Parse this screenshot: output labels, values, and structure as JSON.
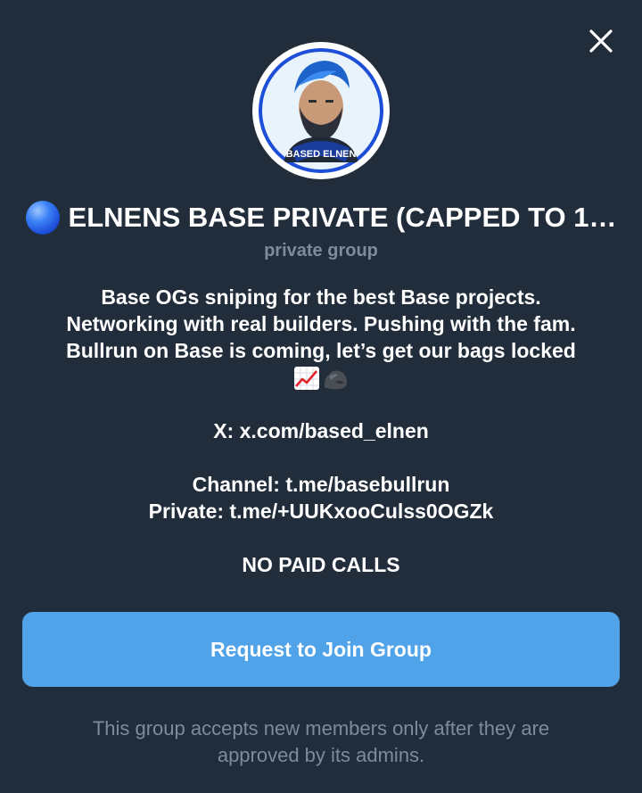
{
  "dialog": {
    "close_label": "Close",
    "avatar_text": "BASED ELNEN",
    "title": "ELNENS BASE PRIVATE (CAPPED TO 1…",
    "subtitle": "private group",
    "description": {
      "line1": "Base OGs sniping for the best Base projects.",
      "line2": "Networking with real builders. Pushing with the fam.",
      "line3": "Bullrun on Base is coming, let’s get our bags locked",
      "x_link": "X: x.com/based_elnen",
      "channel": "Channel: t.me/basebullrun",
      "private": "Private: t.me/+UUKxooCulss0OGZk",
      "no_paid": "NO PAID CALLS"
    },
    "join_button": "Request to Join Group",
    "footer": {
      "line1": "This group accepts new members only after they are",
      "line2": "approved by its admins."
    }
  },
  "colors": {
    "background": "#212d3b",
    "accent": "#50a2e9",
    "muted_text": "#7f8b99"
  }
}
